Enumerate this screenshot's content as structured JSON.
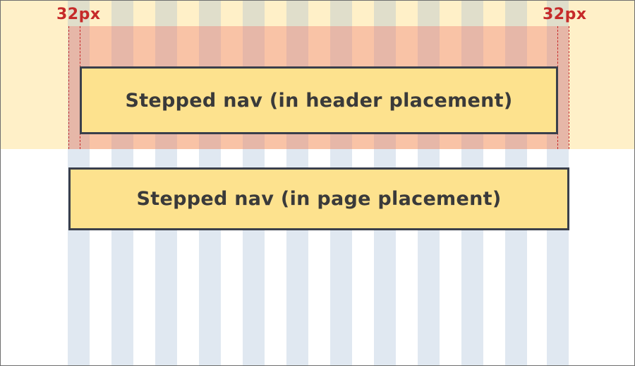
{
  "colors": {
    "header_band": "#fff0c8",
    "grid_column": "#dfe6f1",
    "padding_zone": "#f4c1b0",
    "guide_line": "#c62a2a",
    "component_fill": "#fde28e",
    "component_border": "#3a3f4b",
    "component_text": "#3a3a3a"
  },
  "measurements": {
    "left_label": "32px",
    "right_label": "32px"
  },
  "components": {
    "header_placement": "Stepped nav (in header placement)",
    "page_placement": "Stepped nav (in page placement)"
  }
}
